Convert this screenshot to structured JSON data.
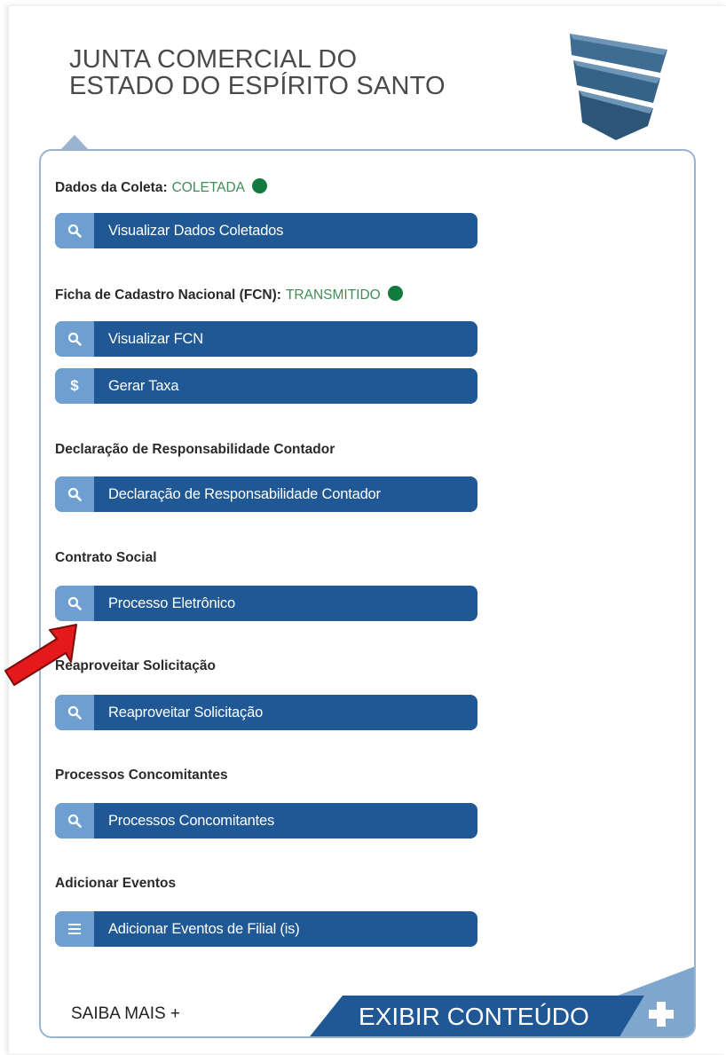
{
  "header": {
    "title_line1": "JUNTA COMERCIAL DO",
    "title_line2": "ESTADO DO ESPÍRITO SANTO",
    "logo_icon": "jucees-logo-icon"
  },
  "sections": [
    {
      "label": "Dados da Coleta:",
      "status": "COLETADA",
      "status_color": "#137a3d"
    },
    {
      "label": "Ficha de Cadastro Nacional (FCN):",
      "status": "TRANSMITIDO",
      "status_color": "#137a3d"
    },
    {
      "label": "Declaração de Responsabilidade Contador"
    },
    {
      "label": "Contrato Social"
    },
    {
      "label": "Reaproveitar Solicitação"
    },
    {
      "label": "Processos Concomitantes"
    },
    {
      "label": "Adicionar Eventos"
    }
  ],
  "buttons": [
    {
      "label": "Visualizar Dados Coletados",
      "icon": "search-icon"
    },
    {
      "label": "Visualizar FCN",
      "icon": "search-icon"
    },
    {
      "label": "Gerar Taxa",
      "icon": "dollar-icon",
      "glyph": "$"
    },
    {
      "label": "Declaração de Responsabilidade Contador",
      "icon": "search-icon"
    },
    {
      "label": "Processo Eletrônico",
      "icon": "search-icon"
    },
    {
      "label": "Reaproveitar Solicitação",
      "icon": "search-icon"
    },
    {
      "label": "Processos Concomitantes",
      "icon": "search-icon"
    },
    {
      "label": "Adicionar Eventos de Filial (is)",
      "icon": "menu-icon"
    }
  ],
  "footer": {
    "saiba_mais": "SAIBA MAIS +",
    "exibir_conteudo": "EXIBIR CONTEÚDO"
  },
  "annotation": {
    "icon": "red-arrow-icon",
    "color": "#e3191b"
  },
  "colors": {
    "button": "#1f5894",
    "button_icon_bg": "#6f9ed1",
    "card_border": "#9ab3cf",
    "status_text": "#3e8f57"
  }
}
